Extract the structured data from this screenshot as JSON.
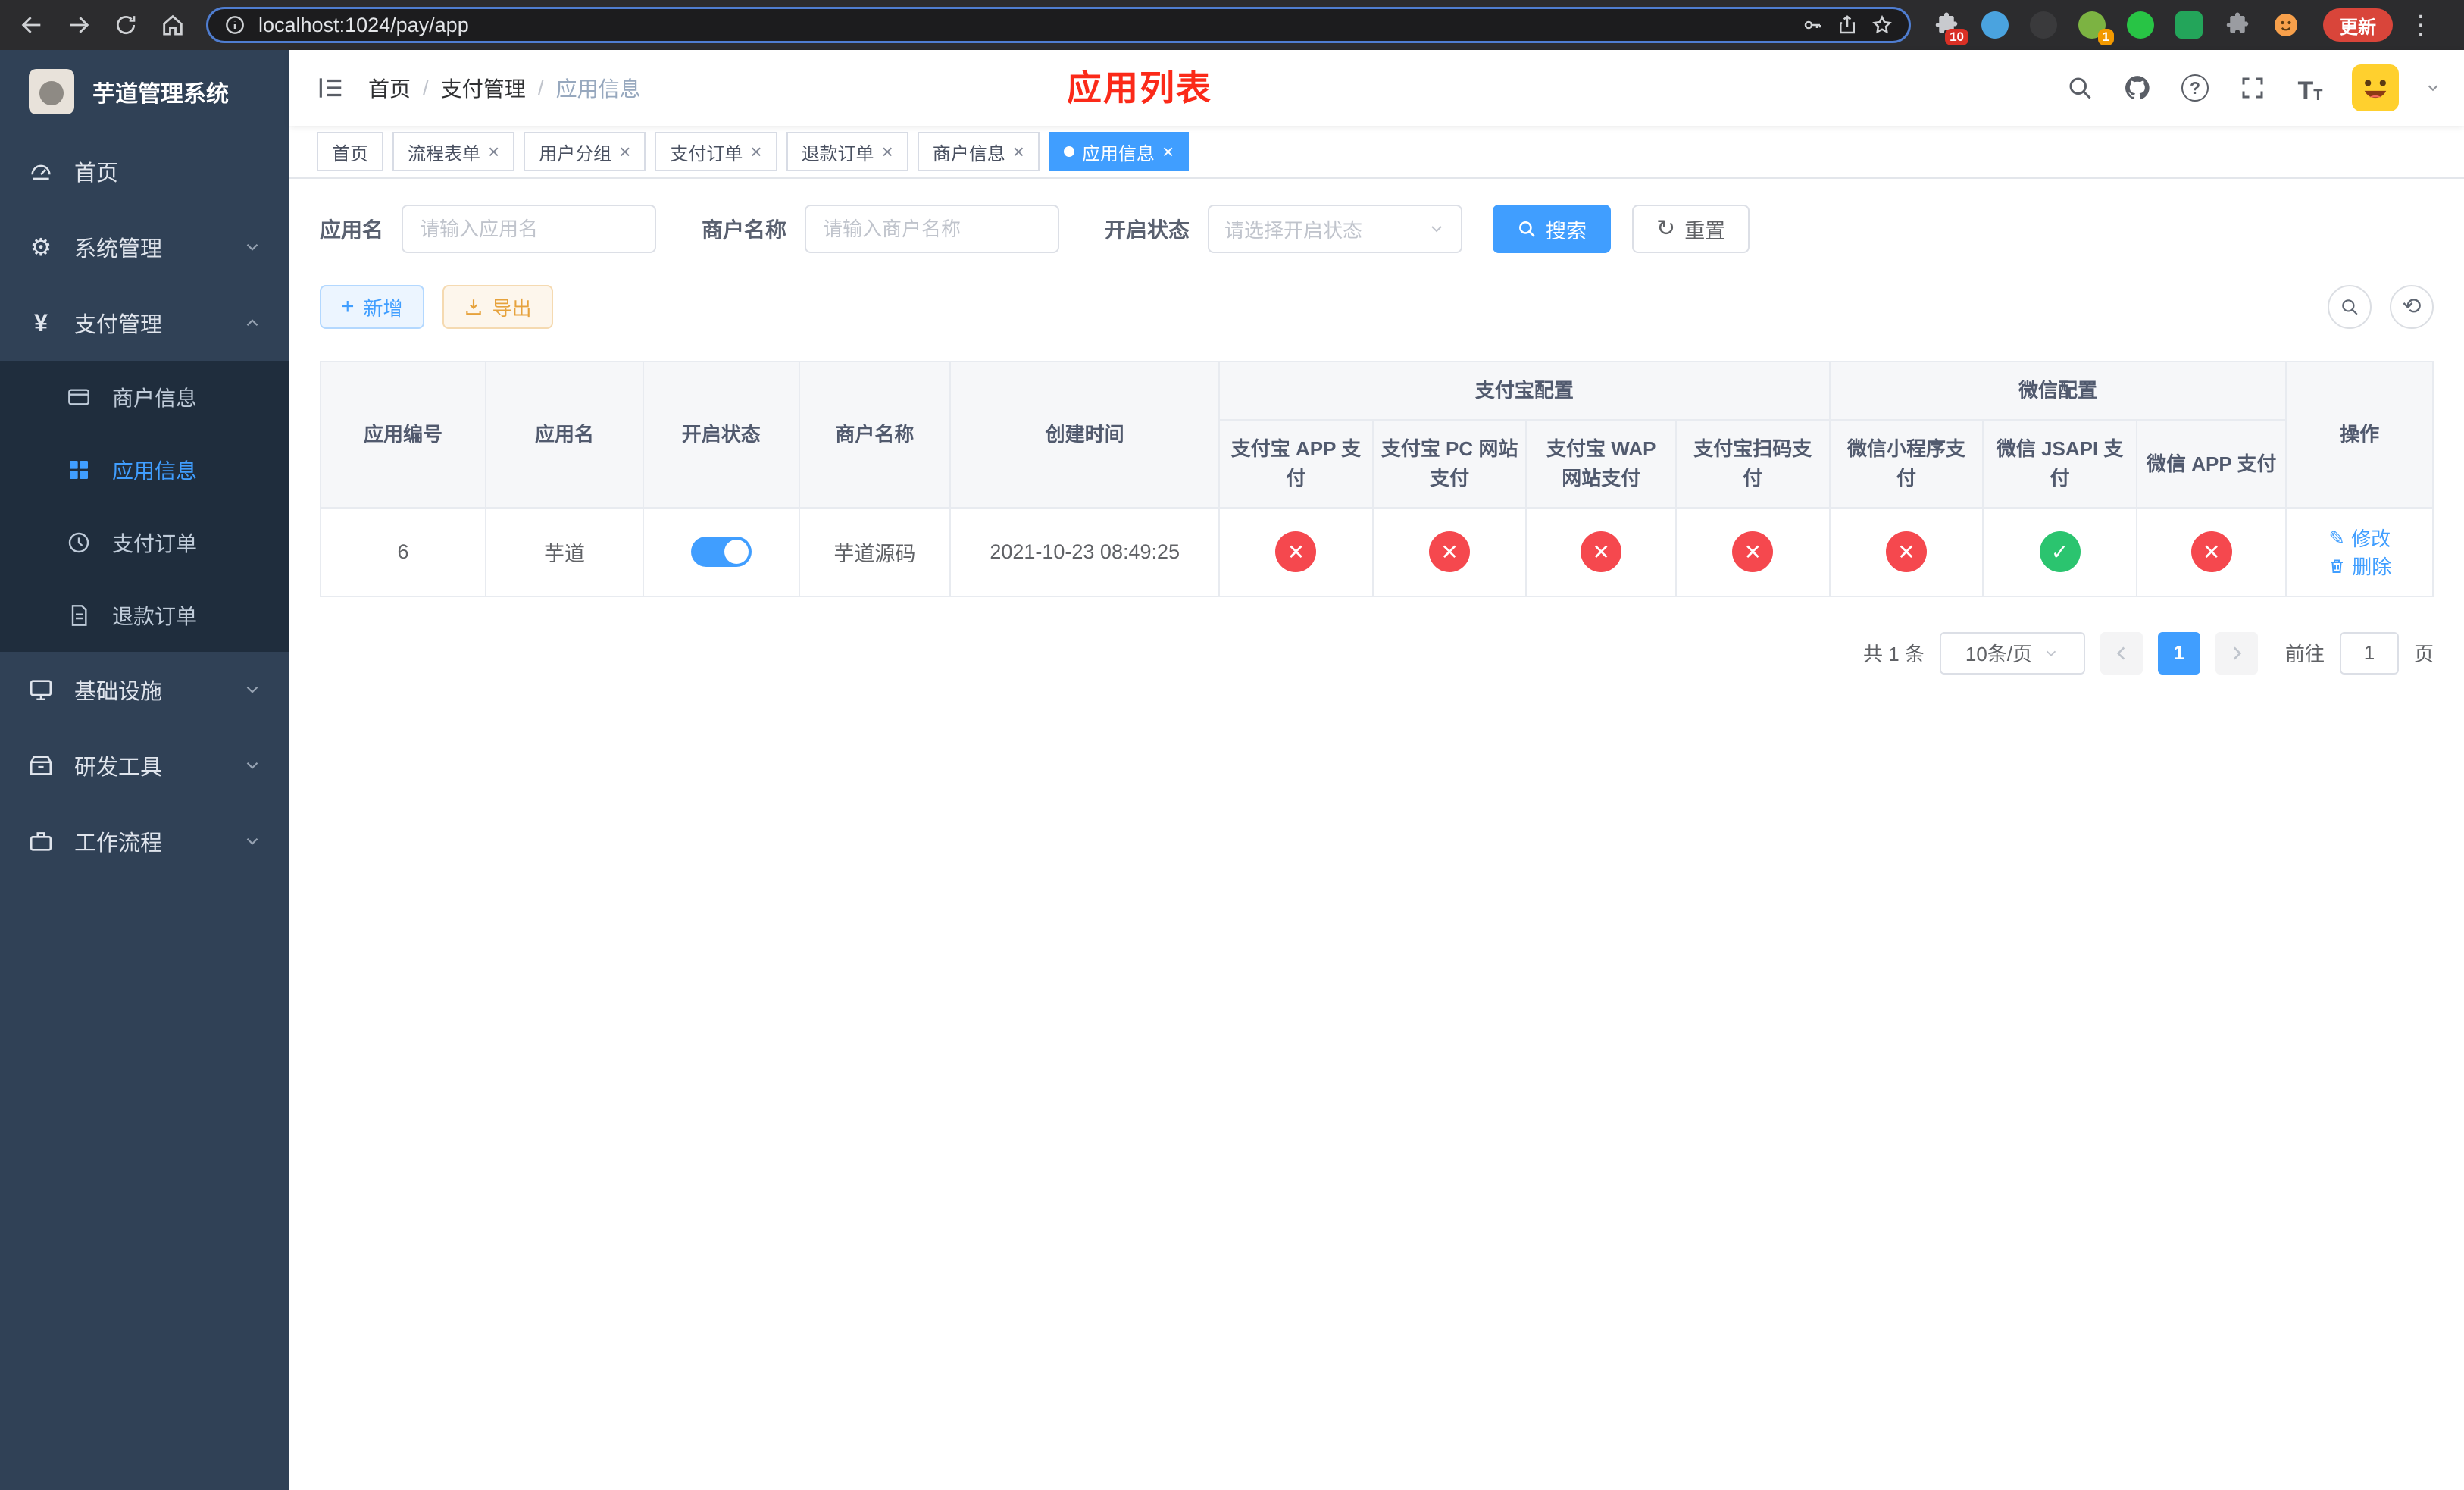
{
  "browser": {
    "url": "localhost:1024/pay/app",
    "update_label": "更新",
    "badge_extensions": "10",
    "badge_profile": "1"
  },
  "sidebar": {
    "title": "芋道管理系统",
    "menu": {
      "home": "首页",
      "system": "系统管理",
      "payment": "支付管理",
      "merchant": "商户信息",
      "app": "应用信息",
      "pay_order": "支付订单",
      "refund_order": "退款订单",
      "infra": "基础设施",
      "devtools": "研发工具",
      "workflow": "工作流程"
    }
  },
  "header": {
    "breadcrumb": {
      "level1": "首页",
      "level2": "支付管理",
      "level3": "应用信息"
    },
    "overlay_title": "应用列表"
  },
  "tabs": [
    {
      "label": "首页"
    },
    {
      "label": "流程表单"
    },
    {
      "label": "用户分组"
    },
    {
      "label": "支付订单"
    },
    {
      "label": "退款订单"
    },
    {
      "label": "商户信息"
    },
    {
      "label": "应用信息"
    }
  ],
  "filters": {
    "app_name_label": "应用名",
    "app_name_placeholder": "请输入应用名",
    "merchant_label": "商户名称",
    "merchant_placeholder": "请输入商户名称",
    "status_label": "开启状态",
    "status_placeholder": "请选择开启状态",
    "search_button": "搜索",
    "reset_button": "重置"
  },
  "toolbar": {
    "add_button": "新增",
    "export_button": "导出"
  },
  "table": {
    "groups": {
      "alipay": "支付宝配置",
      "wechat": "微信配置"
    },
    "columns": {
      "id": "应用编号",
      "name": "应用名",
      "status": "开启状态",
      "merchant": "商户名称",
      "created": "创建时间",
      "alipay_app": "支付宝 APP 支付",
      "alipay_pc": "支付宝 PC 网站支付",
      "alipay_wap": "支付宝 WAP 网站支付",
      "alipay_qr": "支付宝扫码支付",
      "wechat_mini": "微信小程序支付",
      "wechat_jsapi": "微信 JSAPI 支付",
      "wechat_app": "微信 APP 支付",
      "actions": "操作"
    },
    "rows": [
      {
        "id": "6",
        "name": "芋道",
        "status_on": true,
        "merchant": "芋道源码",
        "created": "2021-10-23 08:49:25",
        "alipay_app": false,
        "alipay_pc": false,
        "alipay_wap": false,
        "alipay_qr": false,
        "wechat_mini": false,
        "wechat_jsapi": true,
        "wechat_app": false,
        "edit_label": "修改",
        "delete_label": "删除"
      }
    ]
  },
  "pagination": {
    "total_text": "共 1 条",
    "page_size_text": "10条/页",
    "current_page": "1",
    "goto_label": "前往",
    "goto_value": "1",
    "goto_unit": "页"
  },
  "colors": {
    "primary": "#409eff",
    "success": "#2bc46f",
    "danger": "#f5484e",
    "warning": "#e6a23c",
    "sidebar_bg": "#304156",
    "submenu_bg": "#1f2d3d",
    "title_red": "#fb2a19"
  }
}
